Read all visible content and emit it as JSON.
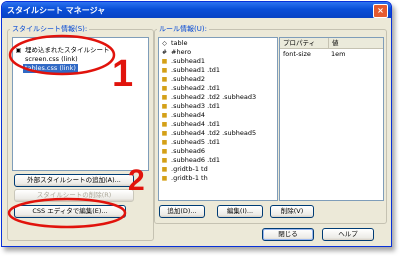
{
  "window": {
    "title": "スタイルシート マネージャ",
    "close_glyph": "×"
  },
  "stylesheet_group": {
    "legend": "スタイルシート情報(S):",
    "items": [
      {
        "label": "埋め込まれたスタイルシート",
        "icon": "stylesheet-icon"
      },
      {
        "label": "screen.css (link)"
      },
      {
        "label": "tables.css (link)",
        "selected": true
      }
    ],
    "buttons": {
      "add_external": "外部スタイルシートの追加(A)...",
      "remove": "スタイルシートの削除(R)",
      "edit_css": "CSS エディタで編集(E)..."
    }
  },
  "rules_group": {
    "legend": "ルール情報(U):",
    "rules": [
      {
        "label": "table",
        "icon": "element-icon"
      },
      {
        "label": "#hero",
        "icon": "id-icon"
      },
      {
        "label": ".subhead1",
        "icon": "class-icon"
      },
      {
        "label": ".subhead1 .td1",
        "icon": "class-icon"
      },
      {
        "label": ".subhead2",
        "icon": "class-icon"
      },
      {
        "label": ".subhead2 .td1",
        "icon": "class-icon"
      },
      {
        "label": ".subhead2 .td2 .subhead3",
        "icon": "class-icon"
      },
      {
        "label": ".subhead3 .td1",
        "icon": "class-icon"
      },
      {
        "label": ".subhead4",
        "icon": "class-icon"
      },
      {
        "label": ".subhead4 .td1",
        "icon": "class-icon"
      },
      {
        "label": ".subhead4 .td2 .subhead5",
        "icon": "class-icon"
      },
      {
        "label": ".subhead5 .td1",
        "icon": "class-icon"
      },
      {
        "label": ".subhead6",
        "icon": "class-icon"
      },
      {
        "label": ".subhead6 .td1",
        "icon": "class-icon"
      },
      {
        "label": ".gridtb-1 td",
        "icon": "class-icon"
      },
      {
        "label": ".gridtb-1 th",
        "icon": "class-icon"
      }
    ],
    "buttons": {
      "add": "追加(D)...",
      "edit": "編集(I)...",
      "delete": "削除(V)"
    }
  },
  "properties": {
    "col_property": "プロパティ",
    "col_value": "値",
    "rows": [
      {
        "property": "font-size",
        "value": "1em"
      }
    ]
  },
  "footer": {
    "close": "閉じる",
    "help": "ヘルプ"
  },
  "annotations": {
    "marker1": "1",
    "marker2": "2",
    "color": "#e1130c"
  }
}
